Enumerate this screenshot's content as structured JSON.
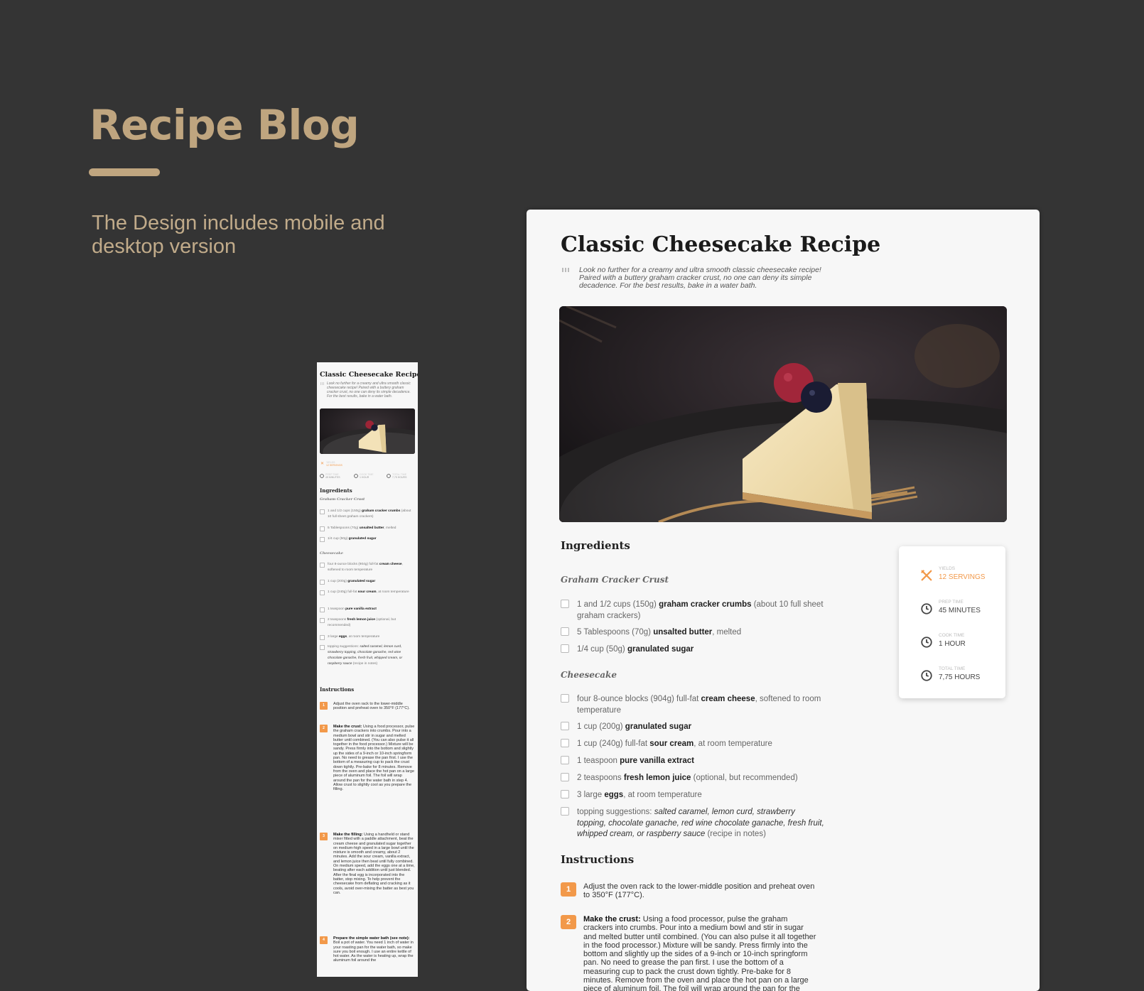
{
  "showcase": {
    "title": "Recipe Blog",
    "subtitle": "The Design includes mobile and desktop version"
  },
  "recipe": {
    "title": "Classic Cheesecake Recipe",
    "intro": "Look no further for a creamy and ultra smooth classic cheesecake recipe! Paired with a buttery graham cracker crust, no one can deny its simple decadence. For the best results, bake in a water bath.",
    "ingredients_heading": "Ingredients",
    "crust_heading": "Graham Cracker Crust",
    "cheesecake_heading": "Cheesecake",
    "instructions_heading": "Instructions",
    "info": {
      "yields_label": "YIELDS",
      "yields_value": "12 SERVINGS",
      "prep_label": "PREP TIME",
      "prep_value": "45 MINUTES",
      "cook_label": "COOK TIME",
      "cook_value": "1 HOUR",
      "total_label": "TOTAL TIME",
      "total_value": "7,75 HOURS"
    },
    "crust_items": [
      {
        "pre": "1 and 1/2 cups (150g) ",
        "bold": "graham cracker crumbs",
        "post": " (about 10 full sheet graham crackers)"
      },
      {
        "pre": "5 Tablespoons (70g) ",
        "bold": "unsalted butter",
        "post": ", melted"
      },
      {
        "pre": "1/4 cup (50g) ",
        "bold": "granulated sugar",
        "post": ""
      }
    ],
    "cheesecake_items": [
      {
        "pre": "four 8-ounce blocks (904g) full-fat ",
        "bold": "cream cheese",
        "post": ", softened to room temperature"
      },
      {
        "pre": "1 cup (200g) ",
        "bold": "granulated sugar",
        "post": ""
      },
      {
        "pre": "1 cup (240g) full-fat ",
        "bold": "sour cream",
        "post": ", at room temperature"
      },
      {
        "pre": "1 teaspoon ",
        "bold": "pure vanilla extract",
        "post": ""
      },
      {
        "pre": "2 teaspoons ",
        "bold": "fresh lemon juice",
        "post": " (optional, but recommended)"
      },
      {
        "pre": "3 large ",
        "bold": "eggs",
        "post": ", at room temperature"
      },
      {
        "pre": "topping suggestions: ",
        "italic": "salted caramel, lemon curd, strawberry topping, chocolate ganache, red wine chocolate ganache, fresh fruit, whipped cream, or raspberry sauce",
        "post": " (recipe in notes)"
      }
    ],
    "steps": [
      {
        "num": "1",
        "bold": "",
        "text": "Adjust the oven rack to the lower-middle position and preheat oven to 350°F (177°C)."
      },
      {
        "num": "2",
        "bold": "Make the crust:",
        "text": " Using a food processor, pulse the graham crackers into crumbs. Pour into a medium bowl and stir in sugar and melted butter until combined. (You can also pulse it all together in the food processor.) Mixture will be sandy. Press firmly into the bottom and slightly up the sides of a 9-inch or 10-inch springform pan. No need to grease the pan first. I use the bottom of a measuring cup to pack the crust down tightly. Pre-bake for 8 minutes. Remove from the oven and place the hot pan on a large piece of aluminum foil. The foil will wrap around the pan for the water bath in step 4. Allow crust to slightly cool as you prepare the filling."
      },
      {
        "num": "3",
        "bold": "Make the filling:",
        "text": " Using a handheld or stand mixer fitted with a paddle attachment, beat the cream cheese and granulated sugar together on medium-high speed in a large bowl until the mixture is smooth and creamy, about 2 minutes. Add the sour cream, vanilla extract, and lemon juice then beat until fully combined. On medium speed, add the eggs one at a time, beating after each addition until just blended. After the final egg is incorporated into the batter, stop mixing. To help prevent the cheesecake from deflating and cracking as it cools, avoid over-mixing the batter as best you can."
      },
      {
        "num": "4",
        "bold": "Prepare the simple water bath (see note):",
        "text": " Boil a pot of water. You need 1 inch of water in your roasting pan for the water bath, so make sure you boil enough. I use an entire kettle of hot water. As the water is heating up, wrap the aluminum foil around the"
      }
    ]
  },
  "colors": {
    "background": "#343434",
    "accent_gold": "#bfa57f",
    "accent_orange": "#f2994a",
    "card_bg": "#f7f7f7"
  }
}
